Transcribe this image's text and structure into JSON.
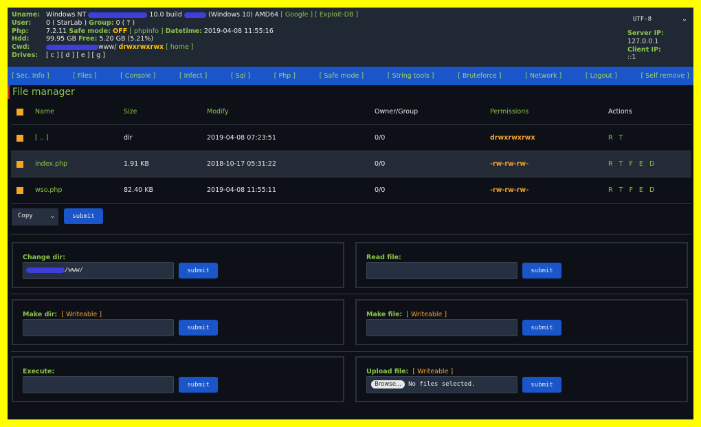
{
  "info": {
    "uname_label": "Uname:",
    "uname_os": "Windows NT",
    "uname_ver": "10.0 build",
    "uname_tail": "(Windows 10) AMD64",
    "google_link": "[ Google ]",
    "exploitdb_link": "[ Exploit-DB ]",
    "user_label": "User:",
    "user_value": "0 ( StarLab ) ",
    "group_label": "Group:",
    "group_value": " 0 ( ? )",
    "php_label": "Php:",
    "php_version": "7.2.11 ",
    "safemode_label": "Safe mode:",
    "safemode_value": " OFF",
    "phpinfo_link": " [ phpinfo ] ",
    "datetime_label": "Datetime:",
    "datetime_value": " 2019-04-08 11:55:16",
    "hdd_label": "Hdd:",
    "hdd_total": "99.95 GB ",
    "free_label": "Free:",
    "hdd_free": " 5.20 GB (5.21%)",
    "cwd_label": "Cwd:",
    "cwd_path": "www/ ",
    "cwd_perm": "drwxrwxrwx",
    "home_link": " [ home ]",
    "drives_label": "Drives:",
    "drives": "[ c ] [ d ] [ e ] [ g ]"
  },
  "charset": {
    "value": "UTF-8"
  },
  "server": {
    "server_ip_label": "Server IP:",
    "server_ip": "127.0.0.1",
    "client_ip_label": "Client IP:",
    "client_ip": "::1"
  },
  "menu": [
    "[ Sec. Info ]",
    "[ Files ]",
    "[ Console ]",
    "[ Infect ]",
    "[ Sql ]",
    "[ Php ]",
    "[ Safe mode ]",
    "[ String tools ]",
    "[ Bruteforce ]",
    "[ Network ]",
    "[ Logout ]",
    "[ Self remove ]"
  ],
  "file_manager": {
    "title": "File manager",
    "headers": {
      "name": "Name",
      "size": "Size",
      "modify": "Modify",
      "owner": "Owner/Group",
      "perms": "Permissions",
      "actions": "Actions"
    },
    "rows": [
      {
        "name": "[ .. ]",
        "size": "dir",
        "modify": "2019-04-08 07:23:51",
        "owner": "0/0",
        "perms": "drwxrwxrwx",
        "actions": "R T"
      },
      {
        "name": "index.php",
        "size": "1.91 KB",
        "modify": "2018-10-17 05:31:22",
        "owner": "0/0",
        "perms": "-rw-rw-rw-",
        "actions": "R T F E D"
      },
      {
        "name": "wso.php",
        "size": "82.40 KB",
        "modify": "2019-04-08 11:55:11",
        "owner": "0/0",
        "perms": "-rw-rw-rw-",
        "actions": "R T F E D"
      }
    ],
    "copy_select": "Copy",
    "submit": "submit"
  },
  "panels": {
    "change_dir": {
      "title": "Change dir:",
      "value": "/www/"
    },
    "read_file": {
      "title": "Read file:"
    },
    "make_dir": {
      "title": "Make dir:",
      "writeable": "[ Writeable ]"
    },
    "make_file": {
      "title": "Make file:",
      "writeable": "[ Writeable ]"
    },
    "execute": {
      "title": "Execute:"
    },
    "upload": {
      "title": "Upload file:",
      "writeable": "[ Writeable ]",
      "browse": "Browse...",
      "no_file": "No files selected."
    },
    "submit": "submit"
  },
  "colors": {
    "accent_green": "#8bc34a",
    "menu_blue": "#1a56c9",
    "perm_orange": "#f0a030",
    "frame_yellow": "#ffff00"
  }
}
